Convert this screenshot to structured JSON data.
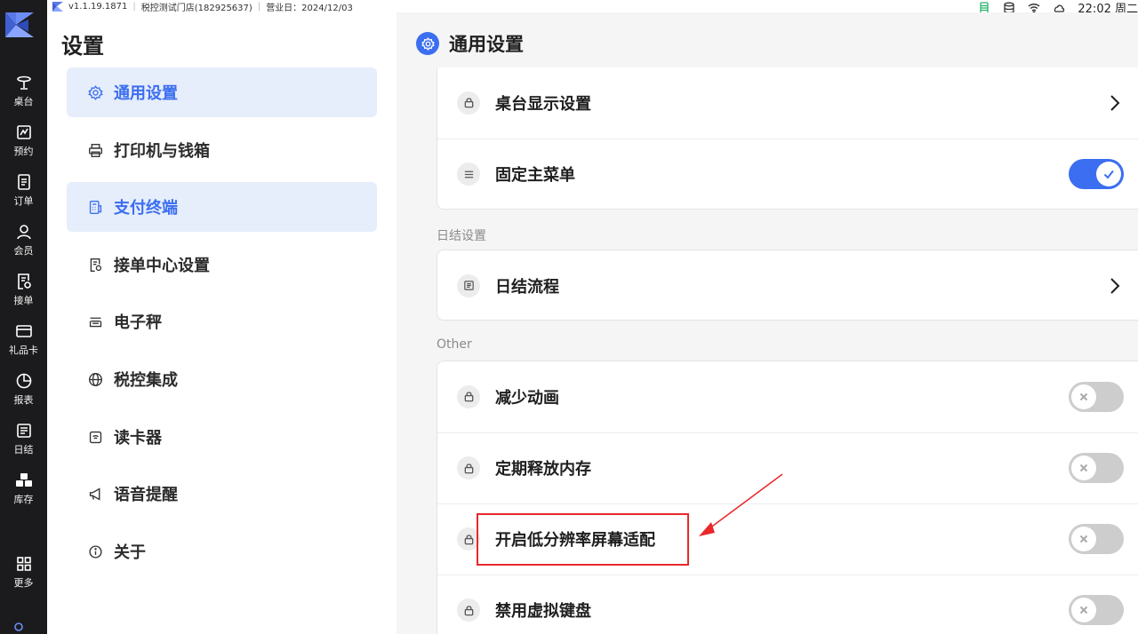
{
  "status_bar": {
    "version": "v1.1.19.1871",
    "store": "税控测试门店(182925637)",
    "business_day": "营业日：2024/12/03",
    "time": "22:02 周二",
    "icons": [
      "battery-icon",
      "database-icon",
      "wifi-icon",
      "cloud-icon"
    ]
  },
  "rail": {
    "items": [
      {
        "label": "桌台",
        "icon": "table-icon"
      },
      {
        "label": "预约",
        "icon": "reservation-icon"
      },
      {
        "label": "订单",
        "icon": "order-icon"
      },
      {
        "label": "会员",
        "icon": "member-icon"
      },
      {
        "label": "接单",
        "icon": "take-order-icon"
      },
      {
        "label": "礼品卡",
        "icon": "gift-card-icon"
      },
      {
        "label": "报表",
        "icon": "report-icon"
      },
      {
        "label": "日结",
        "icon": "daily-close-icon"
      },
      {
        "label": "库存",
        "icon": "inventory-icon"
      },
      {
        "label": "更多",
        "icon": "more-grid-icon"
      }
    ]
  },
  "settings_menu": {
    "title": "设置",
    "items": [
      {
        "label": "通用设置",
        "icon": "gear-icon",
        "active": true
      },
      {
        "label": "打印机与钱箱",
        "icon": "printer-icon",
        "active": false
      },
      {
        "label": "支付终端",
        "icon": "payment-terminal-icon",
        "active": true
      },
      {
        "label": "接单中心设置",
        "icon": "order-center-icon",
        "active": false
      },
      {
        "label": "电子秤",
        "icon": "scale-icon",
        "active": false
      },
      {
        "label": "税控集成",
        "icon": "globe-icon",
        "active": false
      },
      {
        "label": "读卡器",
        "icon": "card-reader-icon",
        "active": false
      },
      {
        "label": "语音提醒",
        "icon": "megaphone-icon",
        "active": false
      },
      {
        "label": "关于",
        "icon": "info-icon",
        "active": false
      }
    ]
  },
  "content": {
    "title": "通用设置",
    "group1": {
      "rows": [
        {
          "label": "桌台显示设置",
          "icon": "lock-icon",
          "control": "chevron"
        },
        {
          "label": "固定主菜单",
          "icon": "menu-lines-icon",
          "control": "toggle",
          "on": true
        }
      ]
    },
    "group2": {
      "header": "日结设置",
      "rows": [
        {
          "label": "日结流程",
          "icon": "list-doc-icon",
          "control": "chevron"
        }
      ]
    },
    "group3": {
      "header": "Other",
      "rows": [
        {
          "label": "减少动画",
          "icon": "lock-icon",
          "control": "toggle",
          "on": false
        },
        {
          "label": "定期释放内存",
          "icon": "lock-icon",
          "control": "toggle",
          "on": false
        },
        {
          "label": "开启低分辨率屏幕适配",
          "icon": "lock-icon",
          "control": "toggle",
          "on": false
        },
        {
          "label": "禁用虚拟键盘",
          "icon": "lock-icon",
          "control": "toggle",
          "on": false
        }
      ]
    }
  },
  "colors": {
    "accent": "#3b6ef0",
    "rail_bg": "#1b1b1d",
    "annotation": "#e8282b"
  }
}
